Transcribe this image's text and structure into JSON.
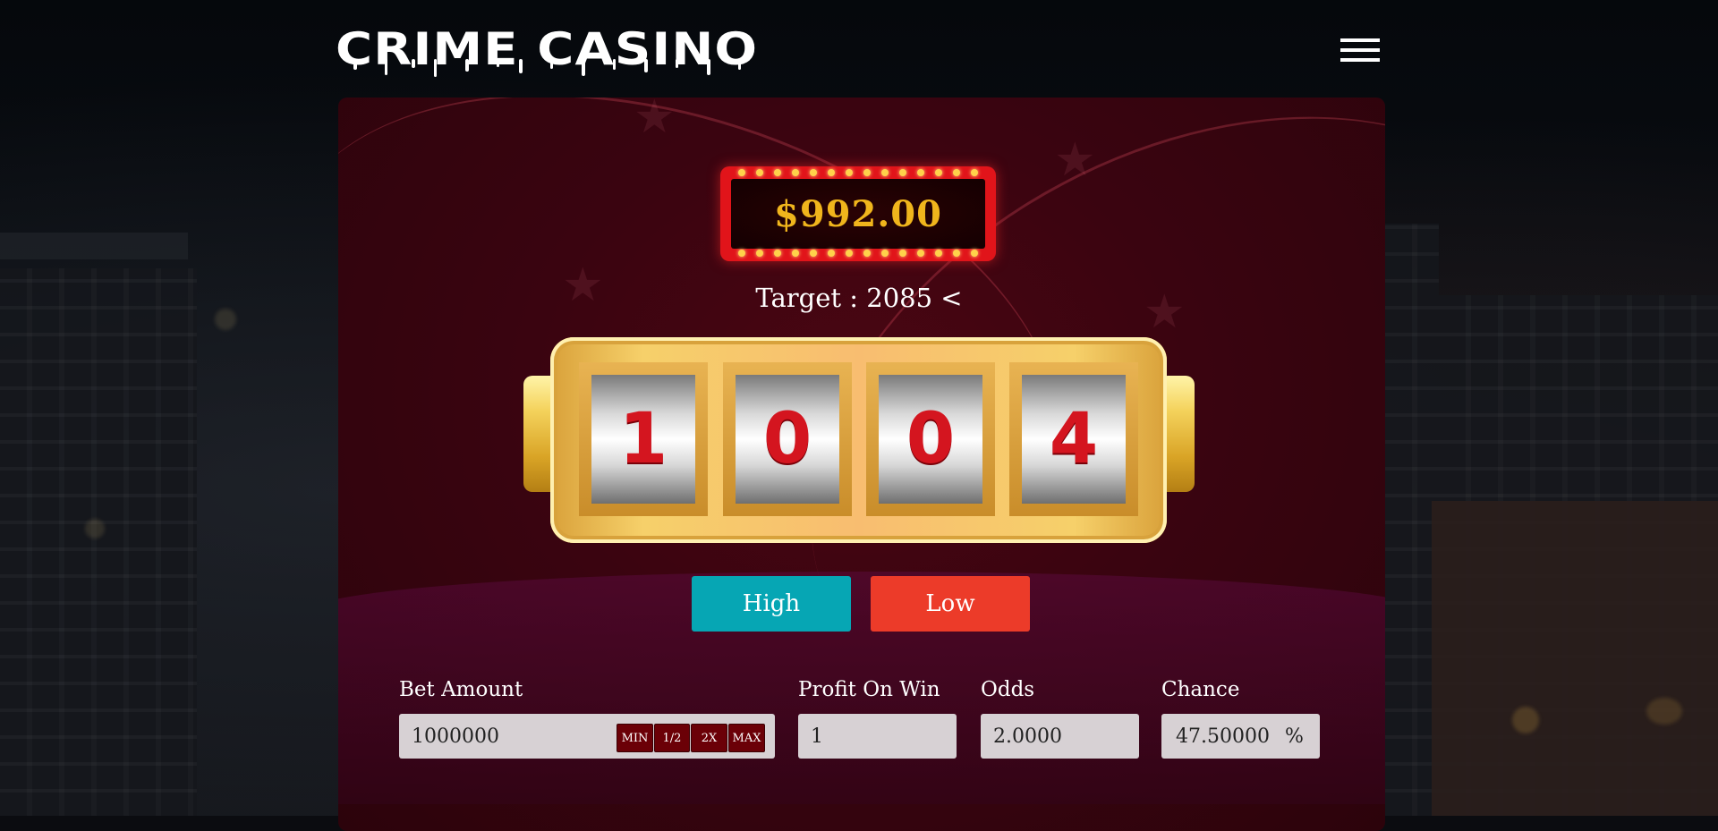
{
  "header": {
    "logo_text": "CRIME CASINO",
    "menu_icon": "hamburger-icon"
  },
  "game": {
    "balance": "$992.00",
    "target_text": "Target : 2085 <",
    "reels": [
      "1",
      "0",
      "0",
      "4"
    ],
    "high_label": "High",
    "low_label": "Low"
  },
  "form": {
    "bet_amount_label": "Bet Amount",
    "bet_amount_value": "1000000",
    "chips": [
      "MIN",
      "1/2",
      "2X",
      "MAX"
    ],
    "profit_label": "Profit On Win",
    "profit_value": "1",
    "odds_label": "Odds",
    "odds_value": "2.0000",
    "chance_label": "Chance",
    "chance_value": "47.50000",
    "chance_unit": "%"
  },
  "colors": {
    "balance_text": "#f0b51c",
    "high_button": "#06a6b4",
    "low_button": "#ec3b29",
    "chip_bg": "#6b0007",
    "reel_digit": "#d4151f"
  }
}
